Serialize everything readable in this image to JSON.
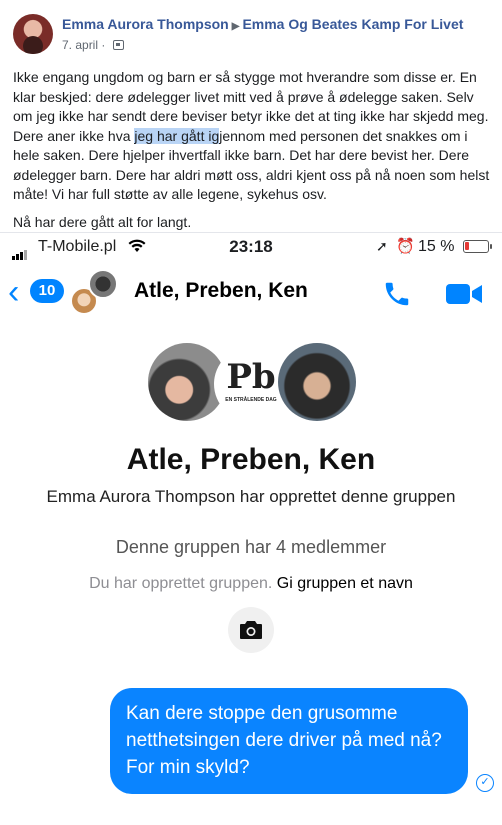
{
  "post": {
    "author": "Emma Aurora Thompson",
    "group": "Emma Og Beates Kamp For Livet",
    "date": "7. april",
    "paragraph1_a": "Ikke engang ungdom og barn er så stygge mot hverandre som disse er. En klar beskjed: dere ødelegger livet mitt ved å prøve å ødelegge saken. Selv om jeg ikke har sendt dere beviser betyr ikke det at ting ikke har skjedd meg. Dere aner ikke hva ",
    "paragraph1_highlight": "jeg har gått ig",
    "paragraph1_b": "jennom med personen det snakkes om i hele saken. Dere hjelper ihvertfall ikke barn. Det har dere bevist her. Dere ødelegger barn. Dere har aldri møtt oss, aldri kjent oss på nå noen som helst måte! Vi har full støtte av alle legene, sykehus osv.",
    "paragraph2": "Nå har dere gått alt for langt."
  },
  "status_bar": {
    "carrier": "T-Mobile.pl",
    "time": "23:18",
    "battery": "15 %"
  },
  "chat": {
    "back_count": "10",
    "title": "Atle, Preben, Ken",
    "group_name": "Atle, Preben, Ken",
    "avatar_logo": "Pb",
    "avatar_logo_sub": "EN STRÅLENDE DAG",
    "creator_line": "Emma Aurora Thompson har opprettet denne gruppen",
    "members_line": "Denne gruppen har 4 medlemmer",
    "created_muted": "Du har opprettet gruppen.",
    "name_link": "Gi gruppen et navn",
    "message": "Kan dere stoppe den grusomme netthetsingen dere driver på med nå? For min skyld?"
  },
  "colors": {
    "messenger_blue": "#0a84ff",
    "facebook_link": "#385898"
  }
}
